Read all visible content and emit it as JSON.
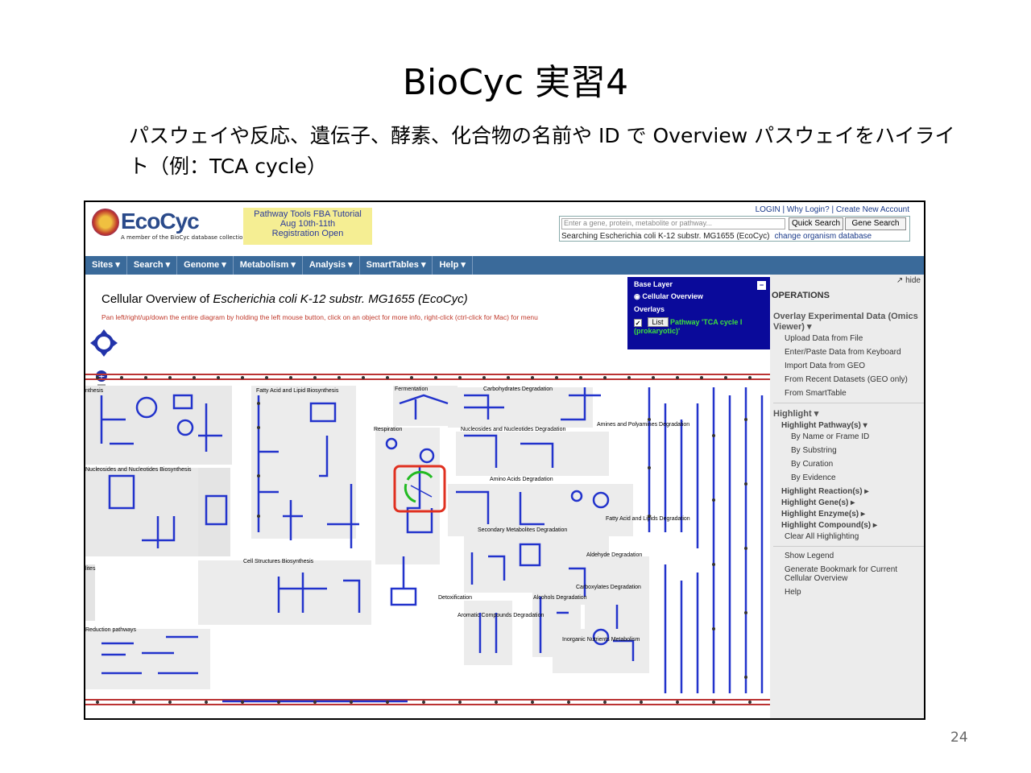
{
  "slide": {
    "title": "BioCyc 実習4",
    "body": "パスウェイや反応、遺伝子、酵素、化合物の名前や ID で Overview パスウェイをハイライト（例：TCA cycle）",
    "page_number": "24"
  },
  "header": {
    "logo_text": "EcoCyc",
    "logo_sub": "A member of the BioCyc database collection",
    "promo": [
      "Pathway Tools FBA Tutorial",
      "Aug 10th-11th",
      "Registration Open"
    ],
    "top_links": "LOGIN | Why Login? | Create New Account",
    "search_placeholder": "Enter a gene, protein, metabolite or pathway...",
    "quick_search": "Quick Search",
    "gene_search": "Gene Search",
    "searching_text": "Searching Escherichia coli K-12 substr. MG1655 (EcoCyc)",
    "change_org": "change organism database"
  },
  "nav": [
    "Sites ▾",
    "Search ▾",
    "Genome ▾",
    "Metabolism ▾",
    "Analysis ▾",
    "SmartTables ▾",
    "Help ▾"
  ],
  "overview": {
    "title_prefix": "Cellular Overview of ",
    "title_org": "Escherichia coli K-12 substr. MG1655 (EcoCyc)",
    "hint": "Pan left/right/up/down the entire diagram by holding the left mouse button, click on an object for more info, right-click (ctrl-click for Mac) for menu"
  },
  "base_layer": {
    "title": "Base Layer",
    "option": "Cellular Overview",
    "overlays_label": "Overlays",
    "list_button": "List",
    "overlay_item": "Pathway 'TCA cycle I (prokaryotic)'"
  },
  "operations": {
    "hide": "↗ hide",
    "title": "OPERATIONS",
    "overlay_header": "Overlay Experimental Data (Omics Viewer) ▾",
    "overlay_items": [
      "Upload Data from File",
      "Enter/Paste Data from Keyboard",
      "Import Data from GEO",
      "From Recent Datasets (GEO only)",
      "From SmartTable"
    ],
    "highlight_header": "Highlight ▾",
    "highlight_pathways": "Highlight Pathway(s) ▾",
    "pathway_items": [
      "By Name or Frame ID",
      "By Substring",
      "By Curation",
      "By Evidence"
    ],
    "highlight_reactions": "Highlight Reaction(s) ▸",
    "highlight_genes": "Highlight Gene(s) ▸",
    "highlight_enzymes": "Highlight Enzyme(s) ▸",
    "highlight_compounds": "Highlight Compound(s) ▸",
    "clear_all": "Clear All Highlighting",
    "show_legend": "Show Legend",
    "bookmark": "Generate Bookmark for Current Cellular Overview",
    "help": "Help"
  },
  "map_labels": {
    "fatty_acid": "Fatty Acid and Lipid Biosynthesis",
    "fermentation": "Fermentation",
    "carbohydrates": "Carbohydrates Degradation",
    "respiration": "Respiration",
    "nucleosides_deg": "Nucleosides and Nucleotides Degradation",
    "amines": "Amines and Polyamines Degradation",
    "nucleosides_bio": "Nucleosides and Nucleotides Biosynthesis",
    "amino_acids": "Amino Acids Degradation",
    "fatty_acid_deg": "Fatty Acid and Lipids Degradation",
    "secondary": "Secondary Metabolites Degradation",
    "aldehyde": "Aldehyde Degradation",
    "cell_structures": "Cell Structures Biosynthesis",
    "carboxylates": "Carboxylates Degradation",
    "detox": "Detoxification",
    "alcohols": "Alcohols Degradation",
    "aromatic": "Aromatic Compounds Degradation",
    "inorganic": "Inorganic Nutrients Metabolism",
    "reduction": "Reduction pathways",
    "synthesis": "nthesis",
    "lites": "lites"
  },
  "colors": {
    "nav_bg": "#3a6a9a",
    "base_layer_bg": "#0a0a9a",
    "pathway_blue": "#2233cc",
    "highlight_green": "#22bb22",
    "highlight_box": "#e03020"
  }
}
